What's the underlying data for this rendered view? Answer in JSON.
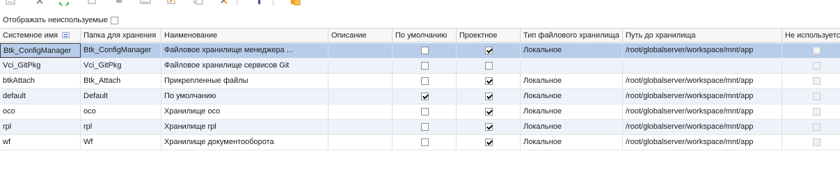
{
  "toolbar": {
    "icons": [
      "list-icon",
      "delete-icon",
      "refresh-icon",
      "document-icon",
      "lock-icon",
      "image-icon",
      "edit-icon",
      "copy-icon",
      "tools-icon",
      "flag-icon",
      "folder-icon"
    ]
  },
  "filter": {
    "label": "Отображать неиспользуемые",
    "checked": false
  },
  "table": {
    "columns": [
      "Системное имя",
      "Папка для хранения",
      "Наименование",
      "Описание",
      "По умолчанию",
      "Проектное",
      "Тип файлового хранилища",
      "Путь до хранилища",
      "Не используется"
    ],
    "rows": [
      {
        "system_name": "Btk_ConfigManager",
        "folder": "Btk_ConfigManager",
        "name": "Файловое хранилище менеджера ...",
        "description": "",
        "default": false,
        "project": true,
        "storage_type": "Локальное",
        "path": "/root/globalserver/workspace/mnt/app",
        "unused": false
      },
      {
        "system_name": "Vci_GitPkg",
        "folder": "Vci_GitPkg",
        "name": "Файловое хранилище сервисов Git",
        "description": "",
        "default": false,
        "project": false,
        "storage_type": "",
        "path": "",
        "unused": false
      },
      {
        "system_name": "btkAttach",
        "folder": "Btk_Attach",
        "name": "Прикрепленные файлы",
        "description": "",
        "default": false,
        "project": true,
        "storage_type": "Локальное",
        "path": "/root/globalserver/workspace/mnt/app",
        "unused": false
      },
      {
        "system_name": "default",
        "folder": "Default",
        "name": "По умолчанию",
        "description": "",
        "default": true,
        "project": true,
        "storage_type": "Локальное",
        "path": "/root/globalserver/workspace/mnt/app",
        "unused": false
      },
      {
        "system_name": "oco",
        "folder": "oco",
        "name": "Хранилище oco",
        "description": "",
        "default": false,
        "project": true,
        "storage_type": "Локальное",
        "path": "/root/globalserver/workspace/mnt/app",
        "unused": false
      },
      {
        "system_name": "rpl",
        "folder": "rpl",
        "name": "Хранилище rpl",
        "description": "",
        "default": false,
        "project": true,
        "storage_type": "Локальное",
        "path": "/root/globalserver/workspace/mnt/app",
        "unused": false
      },
      {
        "system_name": "wf",
        "folder": "Wf",
        "name": "Хранилище документооборота",
        "description": "",
        "default": false,
        "project": true,
        "storage_type": "Локальное",
        "path": "/root/globalserver/workspace/mnt/app",
        "unused": false
      }
    ]
  },
  "colors": {
    "selected_row": "#b7cdea",
    "alt_row": "#eef3fb",
    "toolbar_gray": "#9a9a9a",
    "toolbar_green": "#4caf50",
    "toolbar_orange": "#f0a020"
  }
}
